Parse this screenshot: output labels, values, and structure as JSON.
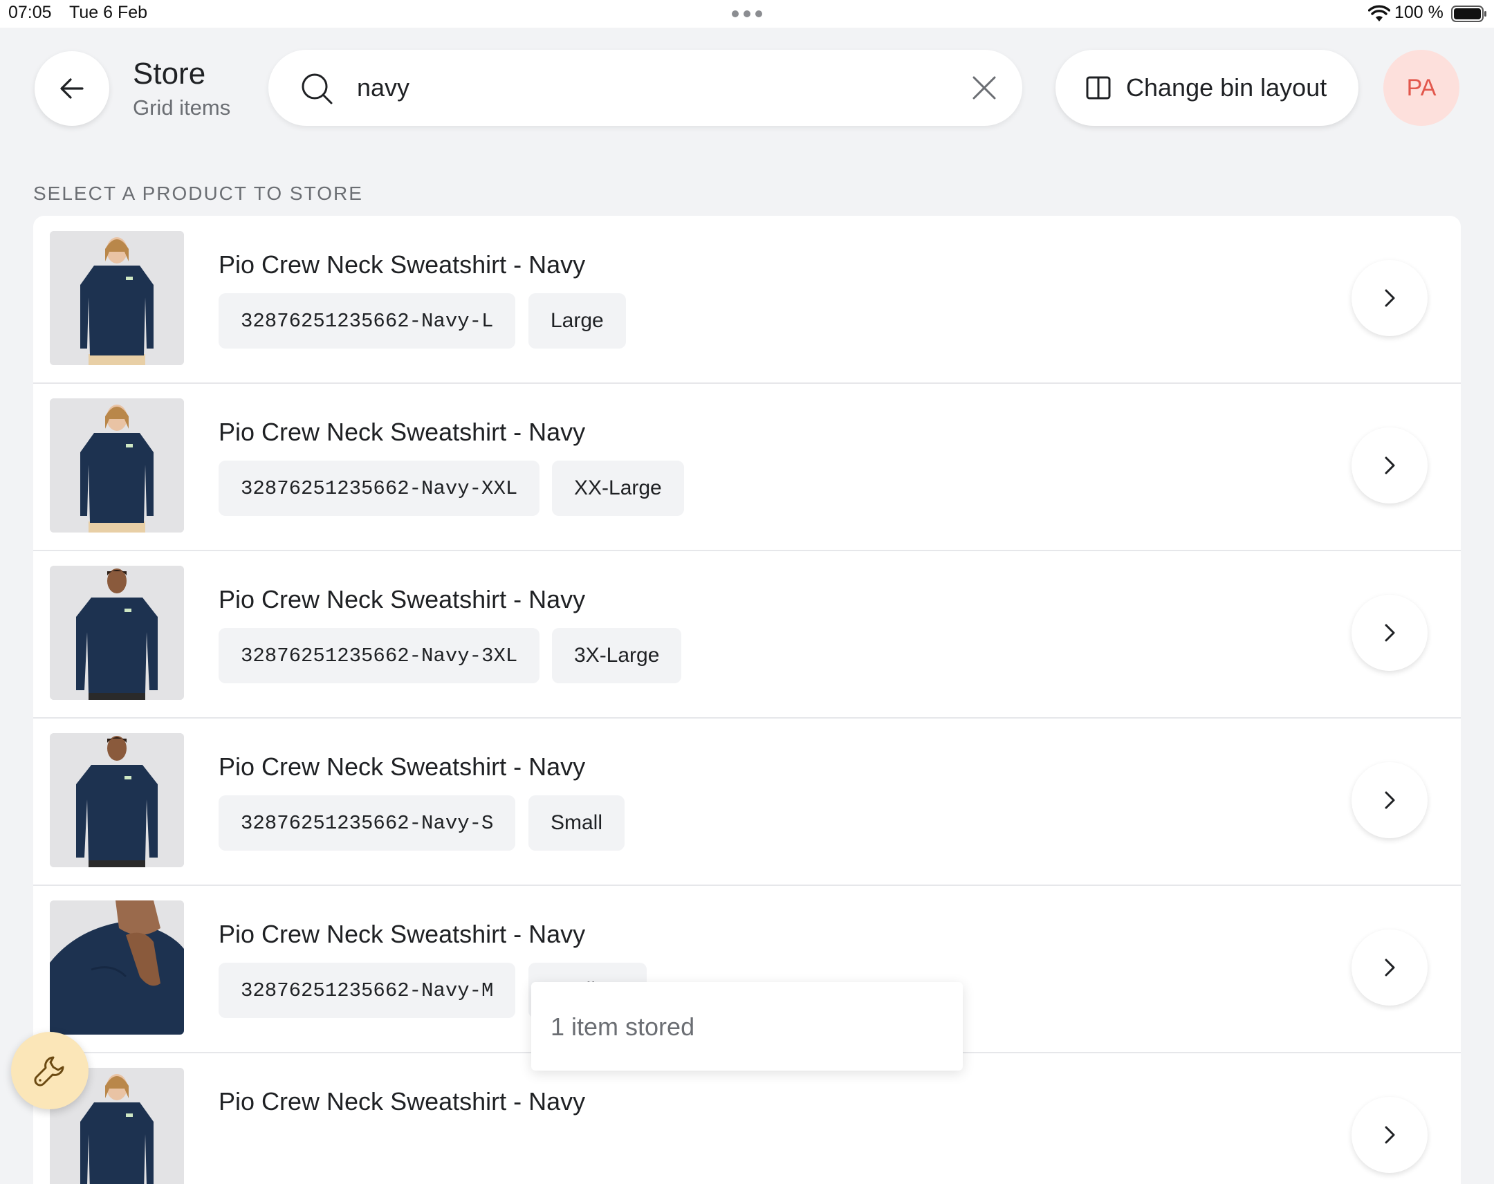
{
  "status_bar": {
    "time": "07:05",
    "date": "Tue 6 Feb",
    "battery": "100 %"
  },
  "header": {
    "title": "Store",
    "subtitle": "Grid items",
    "search": {
      "value": "navy",
      "placeholder": ""
    },
    "layout_button": "Change bin layout",
    "avatar_initials": "PA"
  },
  "section_label": "SELECT A PRODUCT TO STORE",
  "products": [
    {
      "name": "Pio Crew Neck Sweatshirt - Navy",
      "sku": "32876251235662-Navy-L",
      "size": "Large"
    },
    {
      "name": "Pio Crew Neck Sweatshirt - Navy",
      "sku": "32876251235662-Navy-XXL",
      "size": "XX-Large"
    },
    {
      "name": "Pio Crew Neck Sweatshirt - Navy",
      "sku": "32876251235662-Navy-3XL",
      "size": "3X-Large"
    },
    {
      "name": "Pio Crew Neck Sweatshirt - Navy",
      "sku": "32876251235662-Navy-S",
      "size": "Small"
    },
    {
      "name": "Pio Crew Neck Sweatshirt - Navy",
      "sku": "32876251235662-Navy-M",
      "size": "Medium"
    },
    {
      "name": "Pio Crew Neck Sweatshirt - Navy",
      "sku": "",
      "size": ""
    }
  ],
  "toast": "1 item stored",
  "colors": {
    "background": "#f2f3f5",
    "avatar_bg": "#fde0dc",
    "avatar_text": "#e2574c",
    "fab_bg": "#fbe6b8",
    "sweatshirt": "#1d3250"
  },
  "icons": {
    "back": "arrow-left-icon",
    "search": "search-icon",
    "clear": "close-icon",
    "layout": "columns-icon",
    "row_action": "chevron-right-icon",
    "tools": "wrench-icon"
  }
}
